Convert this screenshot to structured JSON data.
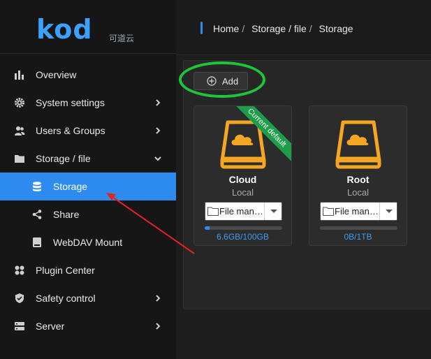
{
  "app": {
    "logo_text": "kod",
    "logo_cn": "可道云"
  },
  "sidebar": {
    "items": [
      {
        "label": "Overview",
        "icon": "bar-chart-icon",
        "has_chevron": false
      },
      {
        "label": "System settings",
        "icon": "gear-icon",
        "has_chevron": true
      },
      {
        "label": "Users & Groups",
        "icon": "users-icon",
        "has_chevron": true
      },
      {
        "label": "Storage / file",
        "icon": "folder-icon",
        "has_chevron": true,
        "expanded": true
      },
      {
        "label": "Storage",
        "icon": "database-icon",
        "sub": true,
        "active": true
      },
      {
        "label": "Share",
        "icon": "share-icon",
        "sub": true
      },
      {
        "label": "WebDAV Mount",
        "icon": "drive-icon",
        "sub": true
      },
      {
        "label": "Plugin Center",
        "icon": "plugin-icon",
        "has_chevron": false
      },
      {
        "label": "Safety control",
        "icon": "shield-icon",
        "has_chevron": true
      },
      {
        "label": "Server",
        "icon": "server-icon",
        "has_chevron": true
      }
    ]
  },
  "breadcrumb": [
    "Home",
    "Storage / file",
    "Storage"
  ],
  "toolbar": {
    "add_label": "Add"
  },
  "cards": [
    {
      "title": "Cloud",
      "type": "Local",
      "select_value": "File man…",
      "usage": "6.6GB/100GB",
      "progress": 0.066,
      "ribbon": "Current default"
    },
    {
      "title": "Root",
      "type": "Local",
      "select_value": "File man…",
      "usage": "0B/1TB",
      "progress": 0
    }
  ],
  "colors": {
    "accent": "#2e8cf0",
    "drive_orange": "#f5a623",
    "annotation_green": "#1ec43a",
    "annotation_red": "#e32222"
  }
}
